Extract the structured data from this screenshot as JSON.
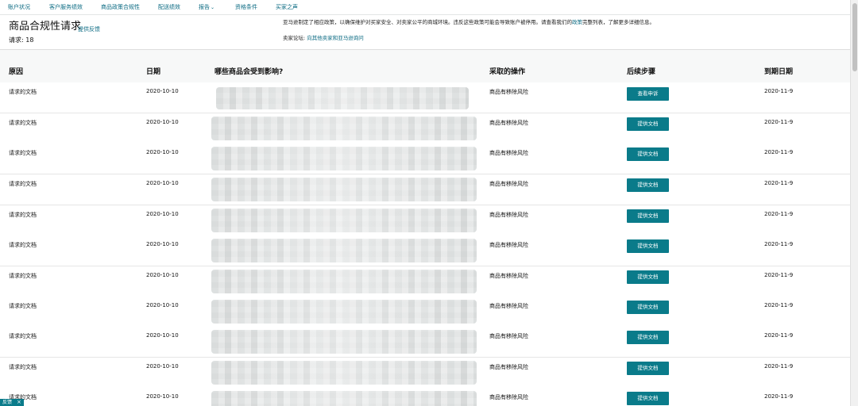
{
  "nav": {
    "items": [
      {
        "label": "账户状况"
      },
      {
        "label": "客户服务绩效"
      },
      {
        "label": "商品政策合规性"
      },
      {
        "label": "配送绩效"
      },
      {
        "label": "报告"
      },
      {
        "label": "资格条件"
      },
      {
        "label": "买家之声"
      }
    ]
  },
  "header": {
    "title": "商品合规性请求",
    "feedback_link": "提供反馈",
    "request_count": "请求: 18",
    "notice_before": "亚马逊制定了相应政策，以确保维护对买家安全、对卖家公平的商城环境。违反这些政策可能会导致账户被停用。请查看我们的",
    "notice_link": "政策",
    "notice_after": "完整列表，了解更多详细信息。",
    "forum_label": "卖家论坛: ",
    "forum_link": "向其他卖家和亚马逊询问"
  },
  "table": {
    "headers": {
      "reason": "原因",
      "date": "日期",
      "affected": "哪些商品会受到影响?",
      "action": "采取的操作",
      "next_step": "后续步骤",
      "due": "到期日期"
    },
    "rows": [
      {
        "reason": "请求的文档",
        "date": "2020-10-10",
        "action": "商品有移除风险",
        "button": "查看申诉",
        "due": "2020-11-9"
      },
      {
        "reason": "请求的文档",
        "date": "2020-10-10",
        "action": "商品有移除风险",
        "button": "提供文档",
        "due": "2020-11-9"
      },
      {
        "reason": "请求的文档",
        "date": "2020-10-10",
        "action": "商品有移除风险",
        "button": "提供文档",
        "due": "2020-11-9"
      },
      {
        "reason": "请求的文档",
        "date": "2020-10-10",
        "action": "商品有移除风险",
        "button": "提供文档",
        "due": "2020-11-9"
      },
      {
        "reason": "请求的文档",
        "date": "2020-10-10",
        "action": "商品有移除风险",
        "button": "提供文档",
        "due": "2020-11-9"
      },
      {
        "reason": "请求的文档",
        "date": "2020-10-10",
        "action": "商品有移除风险",
        "button": "提供文档",
        "due": "2020-11-9"
      },
      {
        "reason": "请求的文档",
        "date": "2020-10-10",
        "action": "商品有移除风险",
        "button": "提供文档",
        "due": "2020-11-9"
      },
      {
        "reason": "请求的文档",
        "date": "2020-10-10",
        "action": "商品有移除风险",
        "button": "提供文档",
        "due": "2020-11-9"
      },
      {
        "reason": "请求的文档",
        "date": "2020-10-10",
        "action": "商品有移除风险",
        "button": "提供文档",
        "due": "2020-11-9"
      },
      {
        "reason": "请求的文档",
        "date": "2020-10-10",
        "action": "商品有移除风险",
        "button": "提供文档",
        "due": "2020-11-9"
      },
      {
        "reason": "请求的文档",
        "date": "2020-10-10",
        "action": "商品有移除风险",
        "button": "提供文档",
        "due": "2020-11-9"
      }
    ]
  },
  "feedback_tab": {
    "label": "反馈"
  },
  "colors": {
    "link": "#0a6a82",
    "button": "#0a7b8a"
  }
}
